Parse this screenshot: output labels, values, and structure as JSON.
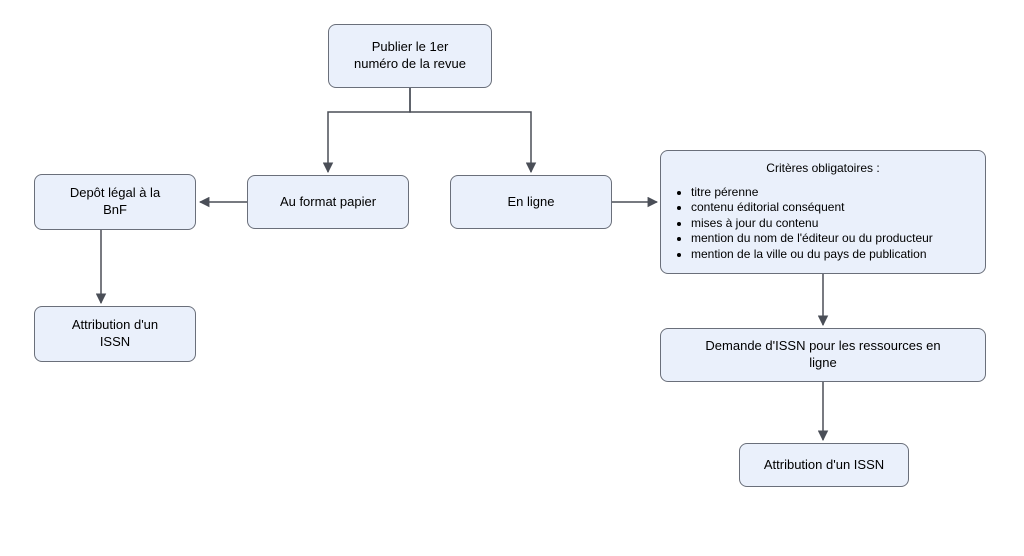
{
  "nodes": {
    "start": {
      "line1": "Publier le 1er",
      "line2": "numéro de la revue"
    },
    "depot": {
      "line1": "Depôt légal à la",
      "line2": "BnF"
    },
    "papier": {
      "label": "Au format papier"
    },
    "enligne": {
      "label": "En ligne"
    },
    "attr1": {
      "line1": "Attribution d'un",
      "line2": "ISSN"
    },
    "criteres": {
      "heading": "Critères obligatoires :",
      "items": [
        "titre pérenne",
        "contenu éditorial conséquent",
        "mises à jour du contenu",
        "mention du nom de l'éditeur ou du producteur",
        "mention de la ville ou du pays de publication"
      ]
    },
    "demande": {
      "line1": "Demande d'ISSN pour les ressources en",
      "line2": "ligne"
    },
    "attr2": {
      "label": "Attribution d'un ISSN"
    }
  },
  "chart_data": {
    "type": "flowchart",
    "nodes": [
      {
        "id": "start",
        "label": "Publier le 1er numéro de la revue"
      },
      {
        "id": "papier",
        "label": "Au format papier"
      },
      {
        "id": "enligne",
        "label": "En ligne"
      },
      {
        "id": "depot",
        "label": "Depôt légal à la BnF"
      },
      {
        "id": "attr1",
        "label": "Attribution d'un ISSN"
      },
      {
        "id": "criteres",
        "label": "Critères obligatoires",
        "items": [
          "titre pérenne",
          "contenu éditorial conséquent",
          "mises à jour du contenu",
          "mention du nom de l'éditeur ou du producteur",
          "mention de la ville ou du pays de publication"
        ]
      },
      {
        "id": "demande",
        "label": "Demande d'ISSN pour les ressources en ligne"
      },
      {
        "id": "attr2",
        "label": "Attribution d'un ISSN"
      }
    ],
    "edges": [
      {
        "from": "start",
        "to": "papier"
      },
      {
        "from": "start",
        "to": "enligne"
      },
      {
        "from": "papier",
        "to": "depot"
      },
      {
        "from": "depot",
        "to": "attr1"
      },
      {
        "from": "enligne",
        "to": "criteres"
      },
      {
        "from": "criteres",
        "to": "demande"
      },
      {
        "from": "demande",
        "to": "attr2"
      }
    ]
  }
}
